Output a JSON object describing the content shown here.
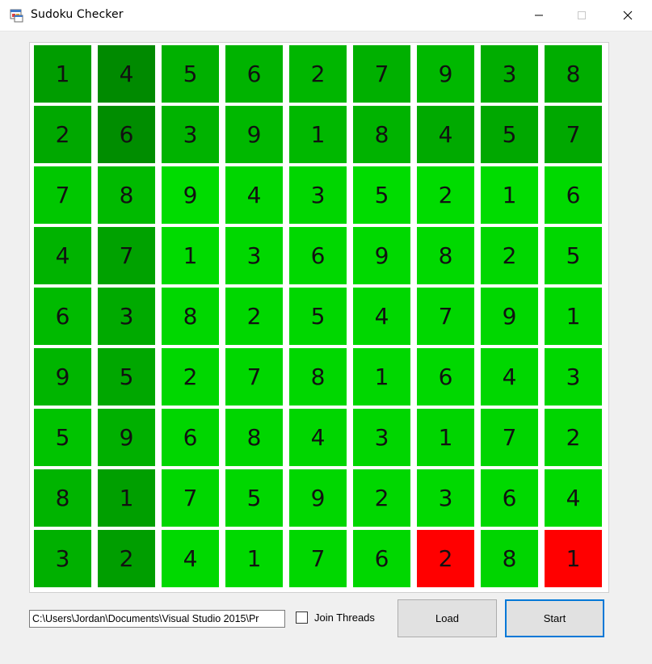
{
  "window": {
    "title": "Sudoku Checker"
  },
  "grid": {
    "rows": [
      [
        1,
        4,
        5,
        6,
        2,
        7,
        9,
        3,
        8
      ],
      [
        2,
        6,
        3,
        9,
        1,
        8,
        4,
        5,
        7
      ],
      [
        7,
        8,
        9,
        4,
        3,
        5,
        2,
        1,
        6
      ],
      [
        4,
        7,
        1,
        3,
        6,
        9,
        8,
        2,
        5
      ],
      [
        6,
        3,
        8,
        2,
        5,
        4,
        7,
        9,
        1
      ],
      [
        9,
        5,
        2,
        7,
        8,
        1,
        6,
        4,
        3
      ],
      [
        5,
        9,
        6,
        8,
        4,
        3,
        1,
        7,
        2
      ],
      [
        8,
        1,
        7,
        5,
        9,
        2,
        3,
        6,
        4
      ],
      [
        3,
        2,
        4,
        1,
        7,
        6,
        2,
        8,
        1
      ]
    ],
    "colors": [
      [
        "#009d00",
        "#008a00",
        "#00b000",
        "#00b300",
        "#00b600",
        "#00b000",
        "#00b800",
        "#00ad00",
        "#00ad00"
      ],
      [
        "#00a800",
        "#008d00",
        "#00b300",
        "#00b800",
        "#00b800",
        "#00b300",
        "#00aa00",
        "#00a800",
        "#00a800"
      ],
      [
        "#00c700",
        "#00ba00",
        "#00dc00",
        "#00d600",
        "#00d600",
        "#00dc00",
        "#00dc00",
        "#00dc00",
        "#00d900"
      ],
      [
        "#00b300",
        "#00a200",
        "#00db00",
        "#00d800",
        "#00d800",
        "#00d900",
        "#00d900",
        "#00d700",
        "#00d700"
      ],
      [
        "#00ba00",
        "#00aa00",
        "#00d700",
        "#00d700",
        "#00d700",
        "#00d700",
        "#00d700",
        "#00d700",
        "#00d700"
      ],
      [
        "#00b500",
        "#00a700",
        "#00d700",
        "#00d700",
        "#00d700",
        "#00d700",
        "#00d800",
        "#00d700",
        "#00d700"
      ],
      [
        "#00c300",
        "#00b000",
        "#00d600",
        "#00d600",
        "#00d600",
        "#00d600",
        "#00d500",
        "#00d500",
        "#00d500"
      ],
      [
        "#00b400",
        "#009f00",
        "#00d700",
        "#00d700",
        "#00d700",
        "#00d700",
        "#00d900",
        "#00d900",
        "#00d900"
      ],
      [
        "#00b000",
        "#009e00",
        "#00d900",
        "#00d900",
        "#00d700",
        "#00d700",
        "#ff0000",
        "#00d500",
        "#ff0000"
      ]
    ]
  },
  "controls": {
    "path_value": "C:\\Users\\Jordan\\Documents\\Visual Studio 2015\\Pr",
    "join_threads_label": "Join Threads",
    "join_threads_checked": false,
    "load_label": "Load",
    "start_label": "Start"
  },
  "icons": {
    "app": "app-icon",
    "minimize": "minimize-icon",
    "maximize": "maximize-icon",
    "close": "close-icon"
  }
}
